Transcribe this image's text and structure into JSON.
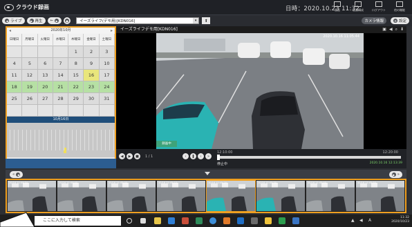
{
  "app": {
    "title": "クラウド録画",
    "clock": "日時：2020.10.23 11:32"
  },
  "top_icons": [
    {
      "label": "画面",
      "icon": "display-icon"
    },
    {
      "label": "画面構成",
      "icon": "layout-icon"
    },
    {
      "label": "ログアウト",
      "icon": "logout-icon"
    },
    {
      "label": "他の機能",
      "icon": "apps-icon"
    }
  ],
  "toolbar": {
    "live_label": "ライブ",
    "playback_label": "再生",
    "back_label": "←",
    "camera_value": "イーズライフ(デモ用)[KDN016]",
    "settings_label": "設定",
    "camera_list_label": "カメラ情報"
  },
  "calendar": {
    "month_title": "2020年10月",
    "weekdays": [
      "日曜日",
      "月曜日",
      "火曜日",
      "水曜日",
      "木曜日",
      "金曜日",
      "土曜日"
    ],
    "rows": [
      [
        "",
        "",
        "",
        "",
        "1",
        "2",
        "3"
      ],
      [
        "4",
        "5",
        "6",
        "7",
        "8",
        "9",
        "10"
      ],
      [
        "11",
        "12",
        "13",
        "14",
        "15",
        "16",
        "17"
      ],
      [
        "18",
        "19",
        "20",
        "21",
        "22",
        "23",
        "24"
      ],
      [
        "25",
        "26",
        "27",
        "28",
        "29",
        "30",
        "31"
      ],
      [
        "",
        "",
        "",
        "",
        "",
        "",
        ""
      ]
    ],
    "recorded_days": [
      "16",
      "18",
      "19",
      "20",
      "21",
      "22",
      "23",
      "24"
    ],
    "selected_day": "16",
    "day_label": "10月16日"
  },
  "video": {
    "camera_title": "イーズライフデモ用[KDN016]",
    "timestamp": "2020.10.16 11:05:44",
    "record_badge": "録画中"
  },
  "controls": {
    "page_text": "1 / 1",
    "time_start": "12:10:00",
    "time_end": "12:20:00",
    "status_left": "停止中",
    "status_right": "2020.10.16 12:13:39"
  },
  "thumbnails": [
    {
      "ts": "10/16 11:44:34"
    },
    {
      "ts": "10/16 11:44:40"
    },
    {
      "ts": "10/16 11:45:00"
    },
    {
      "ts": "10/16 11:45:10"
    },
    {
      "ts": "10/16 11:45:20"
    },
    {
      "ts": "10/16 11:45:30"
    },
    {
      "ts": "10/16 11:45:40"
    },
    {
      "ts": "10/16 11:45:50"
    }
  ],
  "taskbar": {
    "search_placeholder": "ここに入力して検索",
    "time": "11:32",
    "date": "2020/10/23",
    "ime": "A"
  }
}
